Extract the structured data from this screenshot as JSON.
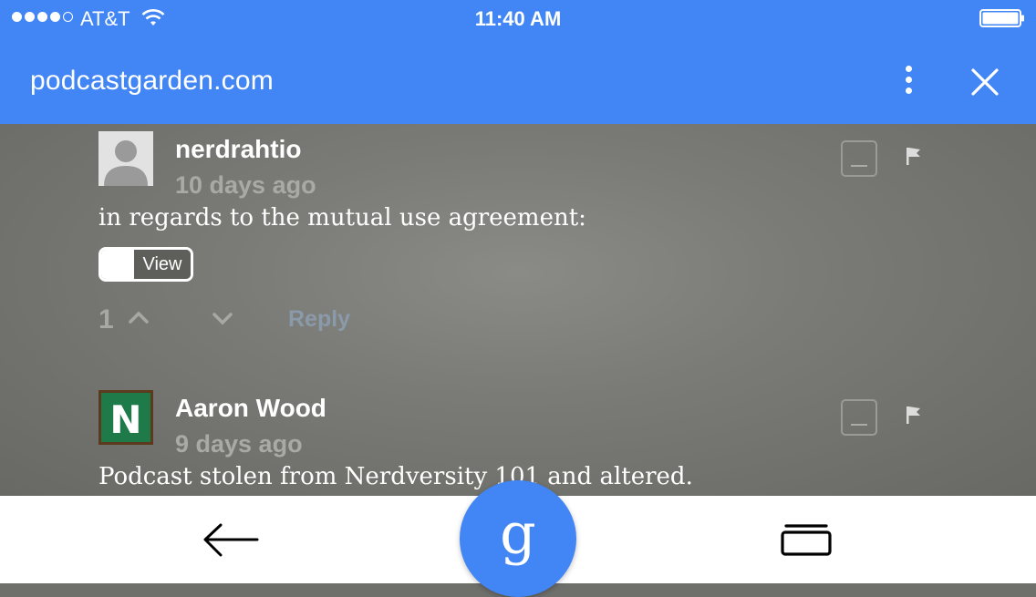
{
  "status_bar": {
    "carrier": "AT&T",
    "time": "11:40 AM",
    "signal_bars": 4,
    "signal_max": 5
  },
  "browser": {
    "url": "podcastgarden.com",
    "menu_icon": "more-vert-icon",
    "close_icon": "close-icon"
  },
  "comments": [
    {
      "author": "nerdrahtio",
      "time_ago": "10 days ago",
      "text": "in regards to the mutual use agreement:",
      "toggle_label": "View",
      "votes": "1",
      "reply_label": "Reply"
    },
    {
      "author": "Aaron Wood",
      "time_ago": "9 days ago",
      "text": "Podcast stolen from Nerdversity 101 and altered.",
      "avatar_letter": "N"
    }
  ],
  "bottom_nav": {
    "back_icon": "back-arrow-icon",
    "google_letter": "g",
    "tabs_icon": "tabs-icon"
  },
  "colors": {
    "accent": "#4285f4",
    "avatar_green": "#1f7a4a"
  }
}
